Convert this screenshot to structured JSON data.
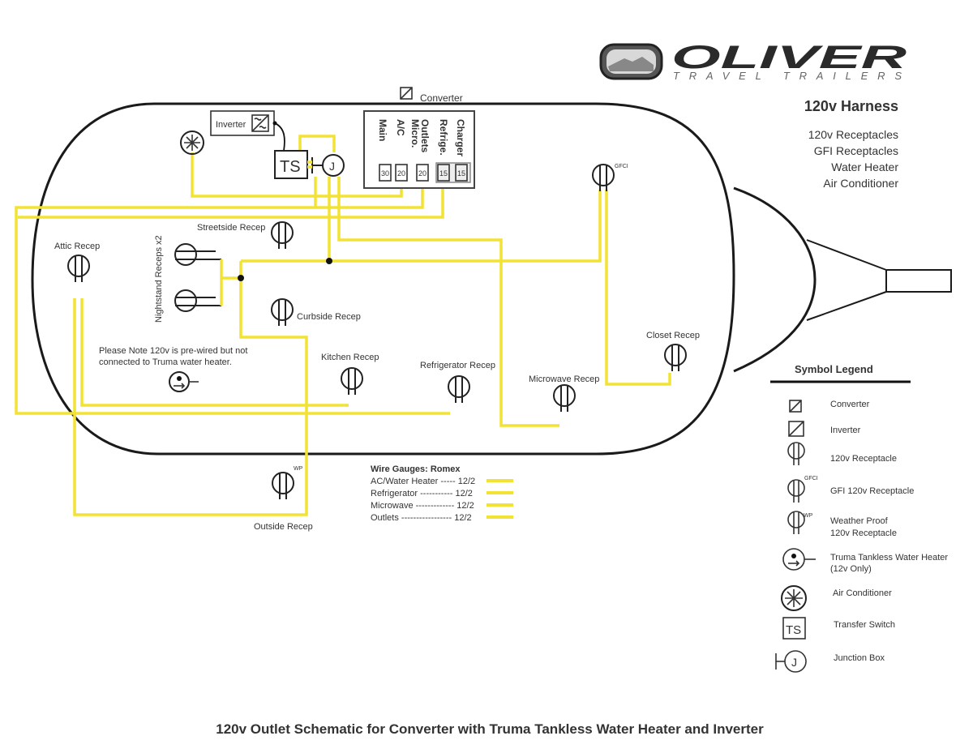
{
  "brand": {
    "name": "OLIVER",
    "tagline": "TRAVEL TRAILERS"
  },
  "harness": {
    "title": "120v Harness",
    "items": [
      "120v Receptacles",
      "GFI Receptacles",
      "Water Heater",
      "Air Conditioner"
    ]
  },
  "converter_panel": {
    "label": "Converter",
    "breakers": [
      {
        "name": "Main",
        "amps": "30"
      },
      {
        "name": "A/C",
        "amps": "20"
      },
      {
        "name": "Outlets Micro.",
        "line1": "Outlets",
        "line2": "Micro.",
        "amps": "20"
      },
      {
        "name": "Refrige.",
        "amps": "15"
      },
      {
        "name": "Charger",
        "amps": "15"
      }
    ]
  },
  "components": {
    "inverter": "Inverter",
    "transfer_switch": "TS",
    "junction": "J"
  },
  "receptacles": {
    "streetside": "Streetside Recep",
    "attic": "Attic Recep",
    "nightstand": "Nightstand Receps x2",
    "curbside": "Curbside Recep",
    "kitchen": "Kitchen Recep",
    "refrigerator": "Refrigerator Recep",
    "microwave": "Microwave Recep",
    "closet": "Closet Recep",
    "outside": "Outside Recep",
    "gfci_tag": "GFCI",
    "wp_tag": "WP"
  },
  "note": {
    "line1": "Please Note 120v is pre-wired but not",
    "line2": "connected to Truma water heater."
  },
  "wire_gauges": {
    "title": "Wire Gauges:  Romex",
    "rows": [
      {
        "label": "AC/Water Heater ----- 12/2"
      },
      {
        "label": "Refrigerator ----------- 12/2"
      },
      {
        "label": "Microwave ------------- 12/2"
      },
      {
        "label": "Outlets ----------------- 12/2"
      }
    ],
    "color": "#f2e233"
  },
  "legend": {
    "title": "Symbol Legend",
    "items": [
      {
        "icon": "converter-icon",
        "label": "Converter"
      },
      {
        "icon": "inverter-icon",
        "label": "Inverter"
      },
      {
        "icon": "receptacle-icon",
        "label": "120v Receptacle"
      },
      {
        "icon": "gfci-receptacle-icon",
        "label": "GFI 120v Receptacle",
        "tag": "GFCI"
      },
      {
        "icon": "weatherproof-receptacle-icon",
        "label1": "Weather Proof",
        "label2": "120v Receptacle",
        "tag": "WP"
      },
      {
        "icon": "water-heater-icon",
        "label1": "Truma Tankless Water Heater",
        "label2": "(12v Only)"
      },
      {
        "icon": "air-conditioner-icon",
        "label": "Air Conditioner"
      },
      {
        "icon": "transfer-switch-icon",
        "label": "Transfer Switch",
        "glyph": "TS"
      },
      {
        "icon": "junction-box-icon",
        "label": "Junction Box",
        "glyph": "J"
      }
    ]
  },
  "caption": "120v Outlet Schematic for Converter with Truma Tankless Water Heater and Inverter"
}
